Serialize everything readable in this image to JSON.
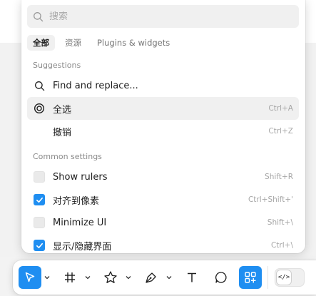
{
  "search": {
    "placeholder": "搜索"
  },
  "tabs": [
    {
      "label": "全部",
      "active": true
    },
    {
      "label": "资源",
      "active": false
    },
    {
      "label": "Plugins & widgets",
      "active": false
    }
  ],
  "sections": {
    "suggestions": "Suggestions",
    "common_settings": "Common settings"
  },
  "suggestions": [
    {
      "label": "Find and replace...",
      "shortcut": "",
      "icon": "search-icon"
    },
    {
      "label": "全选",
      "shortcut": "Ctrl+A",
      "icon": "target-icon",
      "highlighted": true
    },
    {
      "label": "撤销",
      "shortcut": "Ctrl+Z",
      "icon": ""
    }
  ],
  "settings": [
    {
      "label": "Show rulers",
      "shortcut": "Shift+R",
      "checked": false
    },
    {
      "label": "对齐到像素",
      "shortcut": "Ctrl+Shift+'",
      "checked": true
    },
    {
      "label": "Minimize UI",
      "shortcut": "Shift+\\",
      "checked": false
    },
    {
      "label": "显示/隐藏界面",
      "shortcut": "Ctrl+\\",
      "checked": true
    }
  ],
  "toolbar": {
    "tools": [
      "move-tool",
      "frame-tool",
      "shape-tool",
      "pen-tool",
      "text-tool",
      "comment-tool",
      "actions-tool"
    ],
    "dev_mode_label": "</>"
  },
  "colors": {
    "accent": "#1f8ef1"
  }
}
